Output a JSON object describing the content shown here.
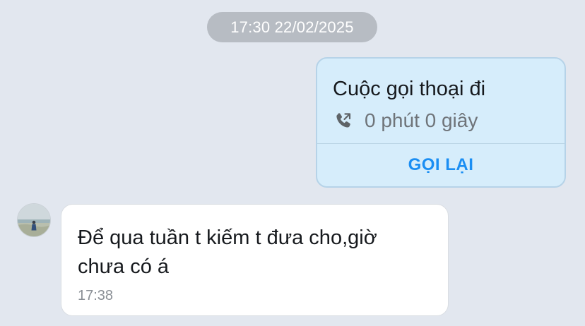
{
  "chat": {
    "timestamp": "17:30 22/02/2025",
    "call_card": {
      "title": "Cuộc gọi thoại đi",
      "duration": "0 phút 0 giây",
      "callback_label": "GỌI LẠI",
      "icon": "outgoing-call-icon"
    },
    "incoming_message": {
      "text": "Để qua tuần t kiếm t đưa cho,giờ\nchưa có á",
      "time": "17:38"
    }
  },
  "colors": {
    "background": "#e2e7ef",
    "call_card_bg": "#d6edfb",
    "accent": "#1a8ef3",
    "pill_bg": "#b7bcc3"
  }
}
